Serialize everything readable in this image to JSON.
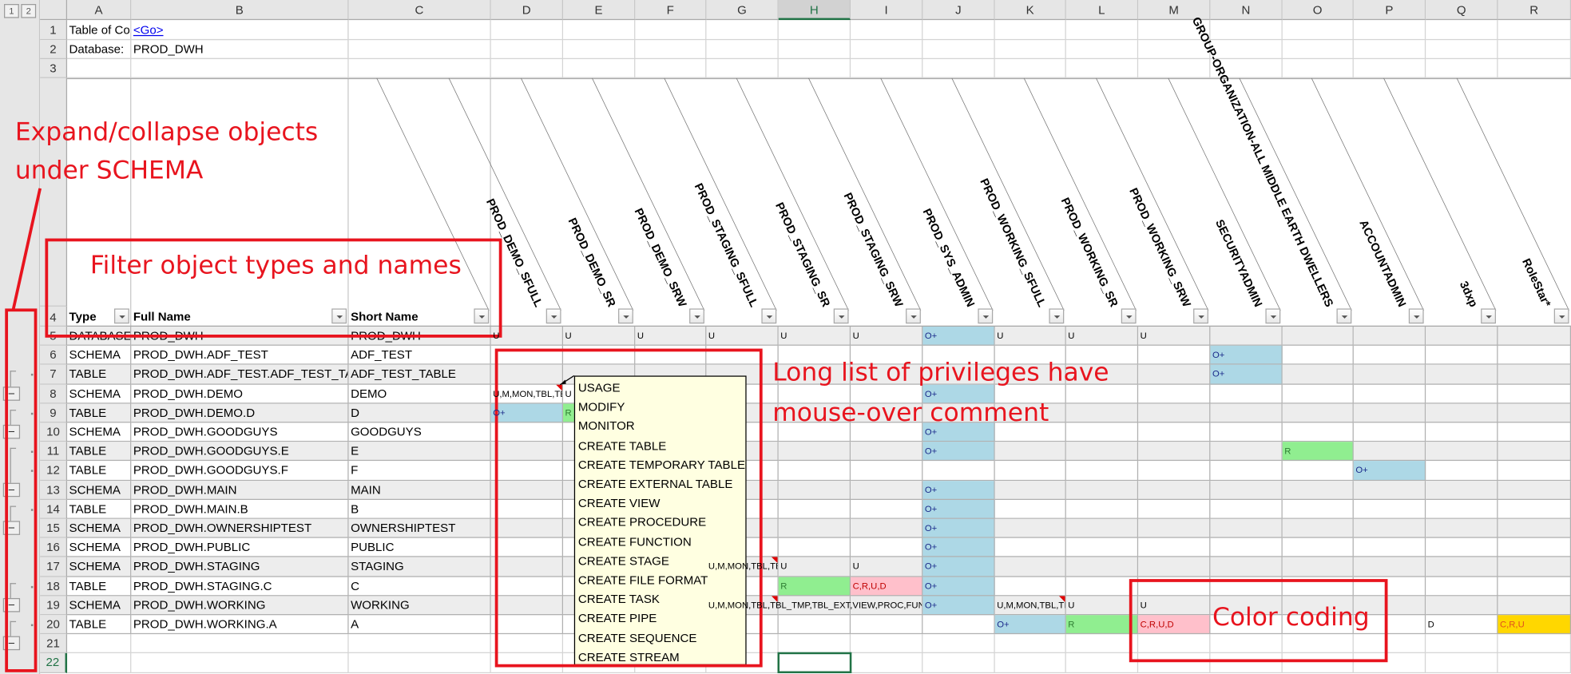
{
  "outline_levels": [
    "1",
    "2"
  ],
  "columns": [
    "A",
    "B",
    "C",
    "D",
    "E",
    "F",
    "G",
    "H",
    "I",
    "J",
    "K",
    "L",
    "M",
    "N",
    "O",
    "P",
    "Q",
    "R"
  ],
  "selected_cell": "H22",
  "top_rows": {
    "r1_label": "Table of Contents",
    "r1_link": "<Go>",
    "r2_label": "Database:",
    "r2_value": "PROD_DWH"
  },
  "header_row": {
    "row_number": "4",
    "type": "Type",
    "full_name": "Full Name",
    "short_name": "Short Name",
    "roles": [
      "PROD_DEMO_SFULL",
      "PROD_DEMO_SR",
      "PROD_DEMO_SRW",
      "PROD_STAGING_SFULL",
      "PROD_STAGING_SR",
      "PROD_STAGING_SRW",
      "PROD_SYS_ADMIN",
      "PROD_WORKING_SFULL",
      "PROD_WORKING_SR",
      "PROD_WORKING_SRW",
      "SECURITYADMIN",
      "GROUP-ORGANIZATION-ALL MIDDLE EARTH DWELLERS",
      "ACCOUNTADMIN",
      "3dxp",
      "RoleStar*"
    ]
  },
  "rows": [
    {
      "n": "5",
      "type": "DATABASE",
      "full": "PROD_DWH",
      "short": "PROD_DWH",
      "cells": {
        "D": {
          "v": "U"
        },
        "E": {
          "v": "U"
        },
        "F": {
          "v": "U"
        },
        "G": {
          "v": "U"
        },
        "H": {
          "v": "U"
        },
        "I": {
          "v": "U"
        },
        "J": {
          "v": "O+",
          "c": "blue"
        },
        "K": {
          "v": "U"
        },
        "L": {
          "v": "U"
        },
        "M": {
          "v": "U"
        }
      }
    },
    {
      "n": "6",
      "type": "SCHEMA",
      "full": "PROD_DWH.ADF_TEST",
      "short": "ADF_TEST",
      "cells": {
        "N": {
          "v": "O+",
          "c": "blue"
        }
      }
    },
    {
      "n": "7",
      "type": "TABLE",
      "full": "PROD_DWH.ADF_TEST.ADF_TEST_TABLE",
      "short": "ADF_TEST_TABLE",
      "cells": {
        "N": {
          "v": "O+",
          "c": "blue"
        }
      }
    },
    {
      "n": "8",
      "type": "SCHEMA",
      "full": "PROD_DWH.DEMO",
      "short": "DEMO",
      "cells": {
        "D": {
          "v": "U,M,MON,TBL,TE",
          "note": true
        },
        "E": {
          "v": "U"
        },
        "J": {
          "v": "O+",
          "c": "blue"
        }
      }
    },
    {
      "n": "9",
      "type": "TABLE",
      "full": "PROD_DWH.DEMO.D",
      "short": "D",
      "cells": {
        "D": {
          "v": "O+",
          "c": "blue"
        },
        "E": {
          "v": "R",
          "c": "green"
        }
      }
    },
    {
      "n": "10",
      "type": "SCHEMA",
      "full": "PROD_DWH.GOODGUYS",
      "short": "GOODGUYS",
      "cells": {
        "J": {
          "v": "O+",
          "c": "blue"
        }
      }
    },
    {
      "n": "11",
      "type": "TABLE",
      "full": "PROD_DWH.GOODGUYS.E",
      "short": "E",
      "cells": {
        "J": {
          "v": "O+",
          "c": "blue"
        },
        "O": {
          "v": "R",
          "c": "green"
        }
      }
    },
    {
      "n": "12",
      "type": "TABLE",
      "full": "PROD_DWH.GOODGUYS.F",
      "short": "F",
      "cells": {
        "P": {
          "v": "O+",
          "c": "blue"
        }
      }
    },
    {
      "n": "13",
      "type": "SCHEMA",
      "full": "PROD_DWH.MAIN",
      "short": "MAIN",
      "cells": {
        "J": {
          "v": "O+",
          "c": "blue"
        }
      }
    },
    {
      "n": "14",
      "type": "TABLE",
      "full": "PROD_DWH.MAIN.B",
      "short": "B",
      "cells": {
        "J": {
          "v": "O+",
          "c": "blue"
        }
      }
    },
    {
      "n": "15",
      "type": "SCHEMA",
      "full": "PROD_DWH.OWNERSHIPTEST",
      "short": "OWNERSHIPTEST",
      "cells": {
        "J": {
          "v": "O+",
          "c": "blue"
        }
      }
    },
    {
      "n": "16",
      "type": "SCHEMA",
      "full": "PROD_DWH.PUBLIC",
      "short": "PUBLIC",
      "cells": {
        "J": {
          "v": "O+",
          "c": "blue"
        }
      }
    },
    {
      "n": "17",
      "type": "SCHEMA",
      "full": "PROD_DWH.STAGING",
      "short": "STAGING",
      "cells": {
        "G": {
          "v": "U,M,MON,TBL,TE",
          "note": true
        },
        "H": {
          "v": "U"
        },
        "I": {
          "v": "U"
        },
        "J": {
          "v": "O+",
          "c": "blue"
        }
      }
    },
    {
      "n": "18",
      "type": "TABLE",
      "full": "PROD_DWH.STAGING.C",
      "short": "C",
      "cells": {
        "H": {
          "v": "R",
          "c": "green"
        },
        "I": {
          "v": "C,R,U,D",
          "c": "pink"
        },
        "J": {
          "v": "O+",
          "c": "blue"
        }
      }
    },
    {
      "n": "19",
      "type": "SCHEMA",
      "full": "PROD_DWH.WORKING",
      "short": "WORKING",
      "cells": {
        "G": {
          "v": "U,M,MON,TBL,TBL_TMP,TBL_EXT,VIEW,PROC,FUNC",
          "note": true,
          "overflow": 3
        },
        "J": {
          "v": "O+",
          "c": "blue"
        },
        "K": {
          "v": "U,M,MON,TBL,TE",
          "note": true
        },
        "L": {
          "v": "U"
        },
        "M": {
          "v": "U"
        }
      }
    },
    {
      "n": "20",
      "type": "TABLE",
      "full": "PROD_DWH.WORKING.A",
      "short": "A",
      "cells": {
        "K": {
          "v": "O+",
          "c": "blue"
        },
        "L": {
          "v": "R",
          "c": "green"
        },
        "M": {
          "v": "C,R,U,D",
          "c": "pink"
        },
        "Q": {
          "v": "D"
        },
        "R": {
          "v": "C,R,U",
          "c": "gold"
        }
      }
    },
    {
      "n": "21",
      "type": "",
      "full": "",
      "short": "",
      "cells": {}
    },
    {
      "n": "22",
      "type": "",
      "full": "",
      "short": "",
      "cells": {}
    }
  ],
  "comment_items": [
    "USAGE",
    "MODIFY",
    "MONITOR",
    "CREATE TABLE",
    "CREATE TEMPORARY TABLE",
    "CREATE EXTERNAL TABLE",
    "CREATE VIEW",
    "CREATE PROCEDURE",
    "CREATE FUNCTION",
    "CREATE STAGE",
    "CREATE FILE FORMAT",
    "CREATE TASK",
    "CREATE PIPE",
    "CREATE SEQUENCE",
    "CREATE STREAM"
  ],
  "annotations": {
    "expand_collapse": [
      "Expand/collapse objects",
      "under SCHEMA"
    ],
    "filter": "Filter object types and names",
    "privileges": [
      "Long list of privileges  have",
      "mouse-over comment"
    ],
    "color_coding": "Color coding"
  },
  "colors": {
    "owner": "#add8e6",
    "read": "#90ee90",
    "write": "#ffc0cb",
    "custom": "#ffd700",
    "annotation": "#e8141e",
    "selection": "#217346"
  }
}
